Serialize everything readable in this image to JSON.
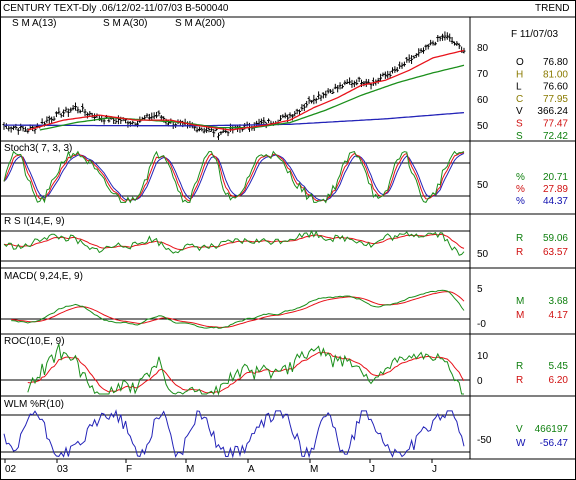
{
  "header": {
    "title": "CENTURY TEXT-Dly .06/12/02-11/07/03  B-500040",
    "right_label": "TREND",
    "date": "F 11/07/03"
  },
  "colors": {
    "price": "#000000",
    "sma13": "#e8121a",
    "sma30": "#1b8f1b",
    "sma200": "#2424b8",
    "stoch_k": "#1b8f1b",
    "stoch_d": "#e8121a",
    "stoch_slow": "#2424b8",
    "rsi": "#1b8f1b",
    "rsi_sig": "#e8121a",
    "macd": "#1b8f1b",
    "macd_sig": "#e8121a",
    "roc": "#1b8f1b",
    "roc_sig": "#e8121a",
    "wlm": "#2424b8",
    "text_red": "#d01010",
    "text_green": "#108010",
    "text_blue": "#1010b0",
    "text_olive": "#8a7a00"
  },
  "panels": {
    "price": {
      "legend": [
        {
          "text": "S M A(13)",
          "color": "#e8121a"
        },
        {
          "text": "S M A(30)",
          "color": "#1b8f1b"
        },
        {
          "text": "S M A(200)",
          "color": "#2424b8"
        }
      ],
      "ticks": [
        "80",
        "70",
        "60",
        "50"
      ],
      "readouts": [
        {
          "label": "O",
          "value": "76.80",
          "color": "#000000"
        },
        {
          "label": "H",
          "value": "81.00",
          "color": "#8a7a00"
        },
        {
          "label": "L",
          "value": "76.60",
          "color": "#000000"
        },
        {
          "label": "C",
          "value": "77.95",
          "color": "#8a7a00"
        },
        {
          "label": "V",
          "value": "366.24",
          "color": "#000000"
        },
        {
          "label": "S",
          "value": "77.47",
          "color": "#d01010"
        },
        {
          "label": "S",
          "value": "72.42",
          "color": "#108010"
        }
      ]
    },
    "stoch": {
      "legend": "Stoch3( 7, 3, 3)",
      "ticks": [
        "50"
      ],
      "readouts": [
        {
          "label": "%",
          "value": "20.71",
          "color": "#108010"
        },
        {
          "label": "%",
          "value": "27.89",
          "color": "#d01010"
        },
        {
          "label": "%",
          "value": "44.37",
          "color": "#1010b0"
        }
      ]
    },
    "rsi": {
      "legend": "R S I(14,E, 9)",
      "ticks": [
        "50"
      ],
      "readouts": [
        {
          "label": "R",
          "value": "59.06",
          "color": "#108010"
        },
        {
          "label": "R",
          "value": "63.57",
          "color": "#d01010"
        }
      ]
    },
    "macd": {
      "legend": "MACD( 9,24,E, 9)",
      "ticks": [
        "5",
        "-0"
      ],
      "readouts": [
        {
          "label": "M",
          "value": "3.68",
          "color": "#108010"
        },
        {
          "label": "M",
          "value": "4.17",
          "color": "#d01010"
        }
      ]
    },
    "roc": {
      "legend": "ROC(10,E, 9)",
      "ticks": [
        "10",
        "0"
      ],
      "readouts": [
        {
          "label": "R",
          "value": "5.45",
          "color": "#108010"
        },
        {
          "label": "R",
          "value": "6.20",
          "color": "#d01010"
        }
      ]
    },
    "wlm": {
      "legend": "WLM %R(10)",
      "ticks": [
        "-50"
      ],
      "readouts": [
        {
          "label": "V",
          "value": "466197",
          "color": "#108010"
        },
        {
          "label": "W",
          "value": "-56.47",
          "color": "#1010b0"
        }
      ]
    }
  },
  "x_axis": {
    "labels": [
      "02",
      "03",
      "F",
      "M",
      "A",
      "M",
      "J",
      "J"
    ]
  },
  "chart_data": {
    "type": "line",
    "title": "CENTURY TEXT-Dly .06/12/02-11/07/03  B-500040",
    "x_range": [
      "06/12/02",
      "11/07/03"
    ],
    "price_ylim": [
      44,
      89
    ],
    "price_anchors": [
      [
        0,
        50
      ],
      [
        5,
        49
      ],
      [
        10,
        48
      ],
      [
        15,
        50
      ],
      [
        20,
        53
      ],
      [
        25,
        55
      ],
      [
        30,
        57
      ],
      [
        35,
        55
      ],
      [
        40,
        53
      ],
      [
        45,
        52
      ],
      [
        50,
        52
      ],
      [
        55,
        51
      ],
      [
        60,
        53
      ],
      [
        65,
        54
      ],
      [
        70,
        51
      ],
      [
        75,
        50
      ],
      [
        80,
        49
      ],
      [
        85,
        48
      ],
      [
        90,
        47
      ],
      [
        95,
        48
      ],
      [
        100,
        49
      ],
      [
        105,
        50
      ],
      [
        110,
        51
      ],
      [
        115,
        52
      ],
      [
        120,
        54
      ],
      [
        125,
        57
      ],
      [
        130,
        61
      ],
      [
        135,
        63
      ],
      [
        140,
        65
      ],
      [
        145,
        67
      ],
      [
        150,
        68
      ],
      [
        155,
        67
      ],
      [
        160,
        70
      ],
      [
        165,
        72
      ],
      [
        170,
        76
      ],
      [
        175,
        79
      ],
      [
        180,
        83
      ],
      [
        185,
        86
      ],
      [
        190,
        82
      ],
      [
        193,
        80
      ]
    ],
    "sma13_anchors": [
      [
        10,
        48
      ],
      [
        25,
        52
      ],
      [
        40,
        54
      ],
      [
        55,
        52
      ],
      [
        70,
        52
      ],
      [
        80,
        50
      ],
      [
        95,
        48
      ],
      [
        110,
        50
      ],
      [
        120,
        52
      ],
      [
        130,
        57
      ],
      [
        140,
        61
      ],
      [
        150,
        66
      ],
      [
        160,
        68
      ],
      [
        170,
        72
      ],
      [
        180,
        77
      ],
      [
        193,
        80
      ]
    ],
    "sma30_anchors": [
      [
        15,
        48
      ],
      [
        30,
        51
      ],
      [
        45,
        53
      ],
      [
        60,
        52
      ],
      [
        75,
        51
      ],
      [
        90,
        49
      ],
      [
        105,
        49
      ],
      [
        120,
        51
      ],
      [
        135,
        56
      ],
      [
        150,
        62
      ],
      [
        165,
        67
      ],
      [
        180,
        71
      ],
      [
        193,
        74
      ]
    ],
    "sma200_anchors": [
      [
        0,
        50
      ],
      [
        40,
        49.8
      ],
      [
        80,
        49.7
      ],
      [
        120,
        50.3
      ],
      [
        160,
        52.5
      ],
      [
        193,
        55
      ]
    ],
    "series": [
      {
        "name": "S M A(13)",
        "last": 77.47
      },
      {
        "name": "S M A(30)",
        "last": 72.42
      },
      {
        "name": "S M A(200)"
      },
      {
        "name": "Stoch3( 7, 3, 3)",
        "values": [
          20.71,
          27.89,
          44.37
        ]
      },
      {
        "name": "R S I(14,E, 9)",
        "values": [
          59.06,
          63.57
        ]
      },
      {
        "name": "MACD( 9,24,E, 9)",
        "values": [
          3.68,
          4.17
        ]
      },
      {
        "name": "ROC(10,E, 9)",
        "values": [
          5.45,
          6.2
        ]
      },
      {
        "name": "WLM %R(10)",
        "values": [
          466197,
          -56.47
        ]
      }
    ]
  }
}
